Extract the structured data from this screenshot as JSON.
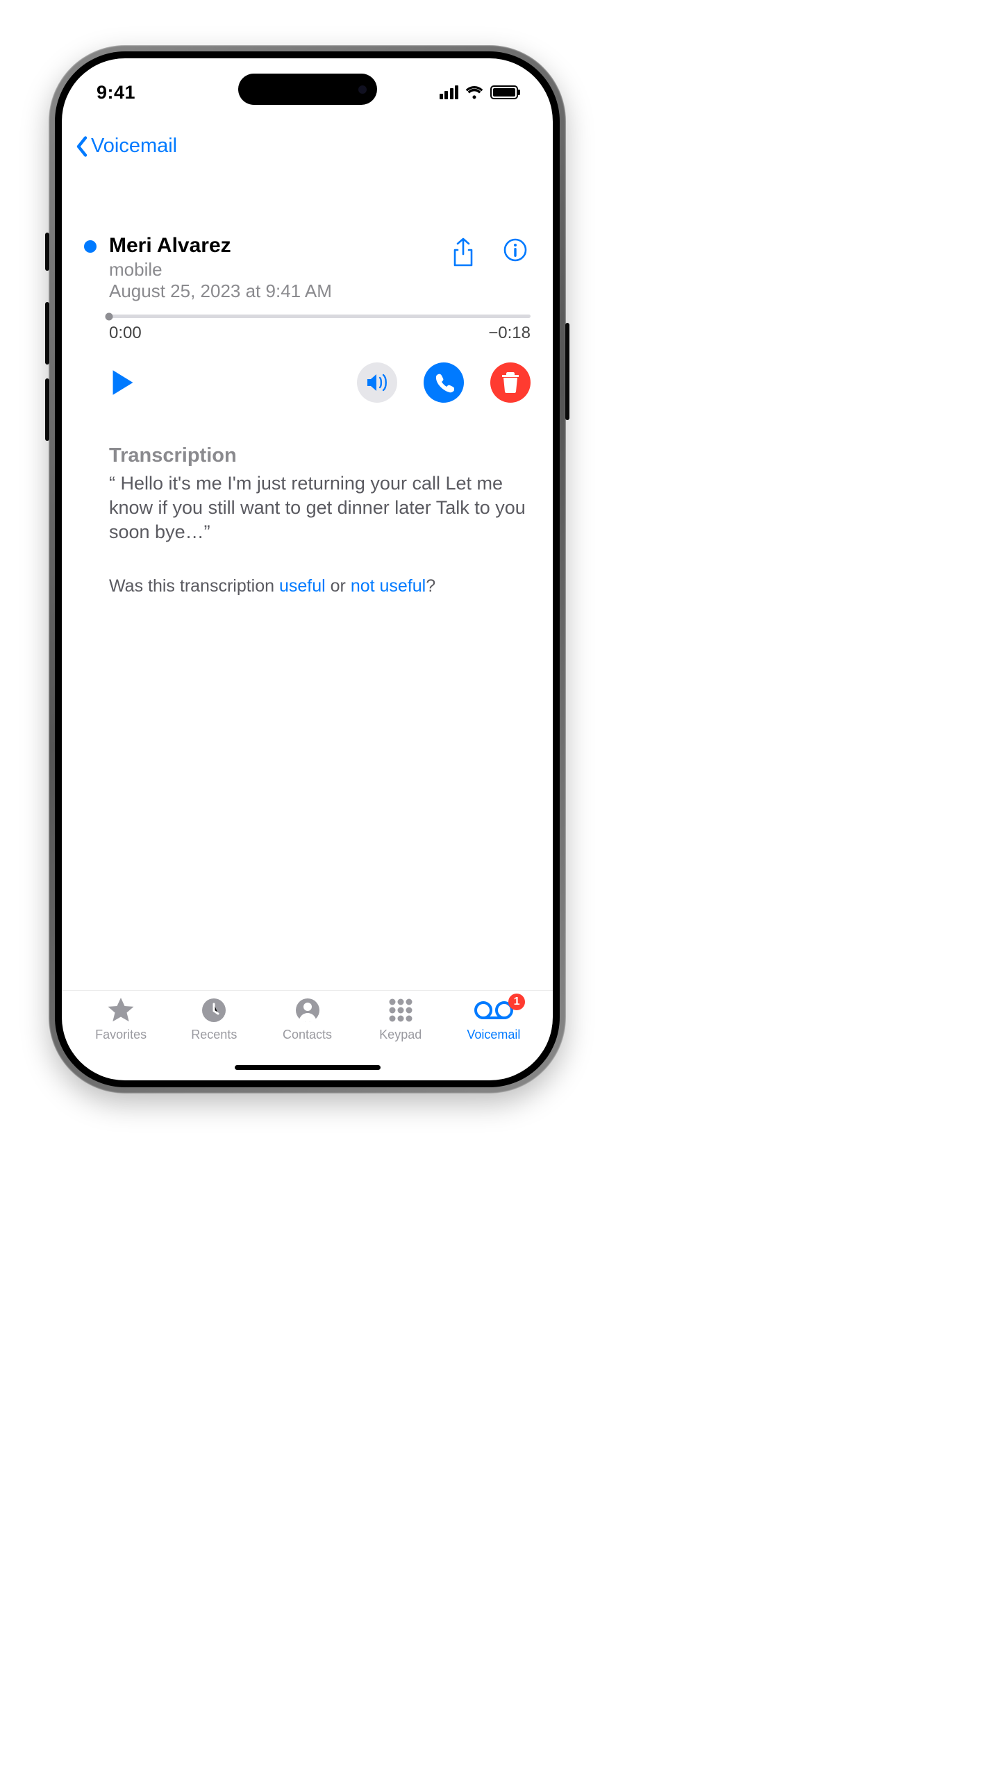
{
  "status": {
    "time": "9:41"
  },
  "nav": {
    "back_label": "Voicemail"
  },
  "voicemail": {
    "caller": "Meri Alvarez",
    "line": "mobile",
    "datetime": "August 25, 2023 at 9:41 AM",
    "elapsed": "0:00",
    "remaining": "−0:18"
  },
  "transcription": {
    "heading": "Transcription",
    "quote_open": "“",
    "text": " Hello it's me I'm just returning your call Let me know if you still want to get dinner later Talk to you soon bye…”",
    "feedback_pre": "Was this transcription ",
    "useful": "useful",
    "or": " or ",
    "not_useful": "not useful",
    "q": "?"
  },
  "tabs": {
    "favorites": "Favorites",
    "recents": "Recents",
    "contacts": "Contacts",
    "keypad": "Keypad",
    "voicemail": "Voicemail",
    "badge": "1"
  },
  "icons": {
    "share": "share-icon",
    "info": "info-icon",
    "play": "play-icon",
    "speaker": "speaker-icon",
    "phone": "phone-icon",
    "trash": "trash-icon",
    "star": "star-icon",
    "clock": "clock-icon",
    "contact": "contact-icon",
    "keypad": "keypad-icon",
    "voicemail": "voicemail-icon",
    "chevron": "chevron-left-icon",
    "signal": "cellular-signal-icon",
    "wifi": "wifi-icon",
    "battery": "battery-icon"
  }
}
